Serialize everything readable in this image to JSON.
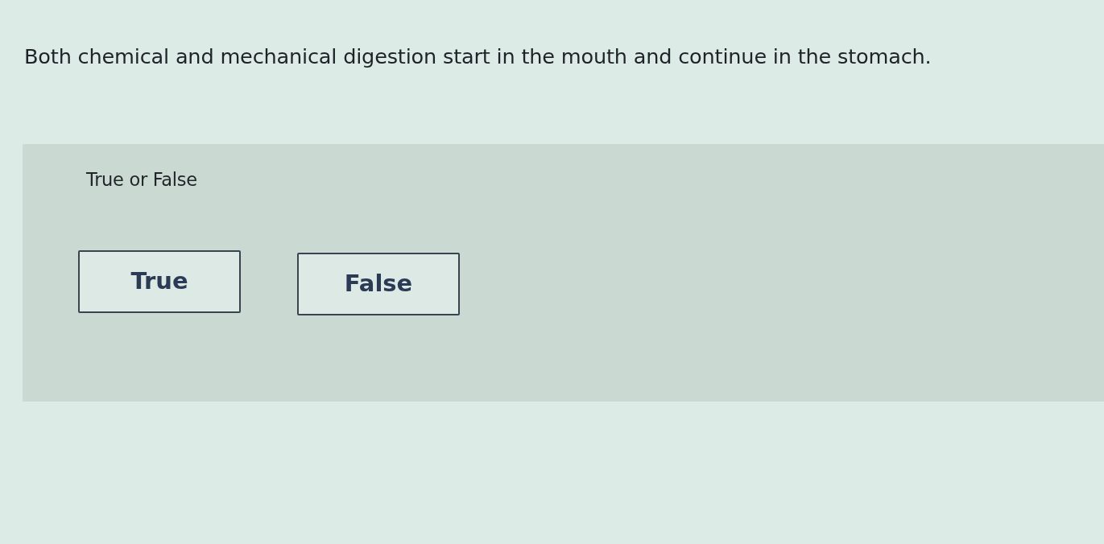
{
  "question": {
    "text": "Both chemical and mechanical digestion start in the mouth and continue in the stomach."
  },
  "answer_panel": {
    "prompt": "True or False",
    "options": [
      {
        "label": "True",
        "selected": false
      },
      {
        "label": "False",
        "selected": false
      }
    ]
  }
}
